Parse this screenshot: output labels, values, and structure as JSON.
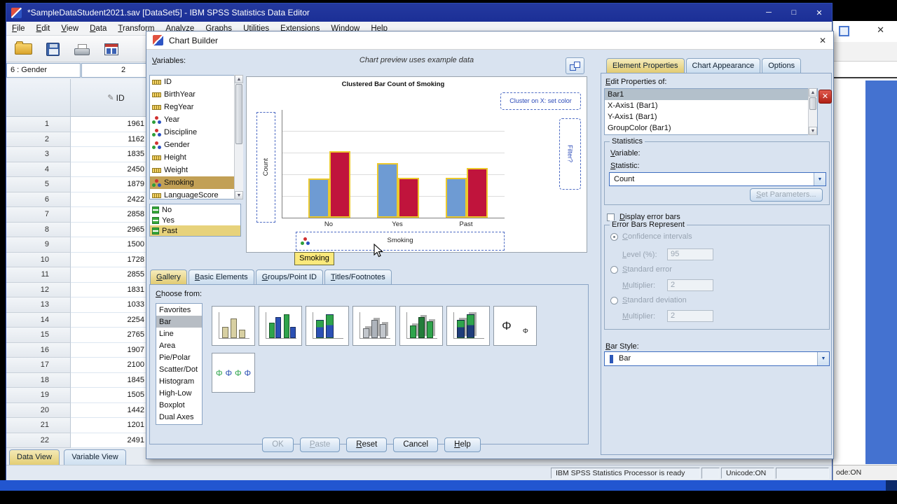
{
  "app": {
    "title": "*SampleDataStudent2021.sav [DataSet5] - IBM SPSS Statistics Data Editor",
    "menu": [
      "File",
      "Edit",
      "View",
      "Data",
      "Transform",
      "Analyze",
      "Graphs",
      "Utilities",
      "Extensions",
      "Window",
      "Help"
    ],
    "toolbar_icons": [
      "open-data",
      "save",
      "print",
      "recall-dialogs"
    ],
    "cell_ref": "6 : Gender",
    "cell_value": "2",
    "view_tabs": [
      "Data View",
      "Variable View"
    ],
    "status": {
      "processor": "IBM SPSS Statistics Processor is ready",
      "unicode": "Unicode:ON"
    }
  },
  "grid": {
    "id_header": "ID",
    "rows": [
      [
        "1",
        "1961"
      ],
      [
        "2",
        "1162"
      ],
      [
        "3",
        "1835"
      ],
      [
        "4",
        "2450"
      ],
      [
        "5",
        "1879"
      ],
      [
        "6",
        "2422"
      ],
      [
        "7",
        "2858"
      ],
      [
        "8",
        "2965"
      ],
      [
        "9",
        "1500"
      ],
      [
        "10",
        "1728"
      ],
      [
        "11",
        "2855"
      ],
      [
        "12",
        "1831"
      ],
      [
        "13",
        "1033"
      ],
      [
        "14",
        "2254"
      ],
      [
        "15",
        "2765"
      ],
      [
        "16",
        "1907"
      ],
      [
        "17",
        "2100"
      ],
      [
        "18",
        "1845"
      ],
      [
        "19",
        "1505"
      ],
      [
        "20",
        "1442"
      ],
      [
        "21",
        "1201"
      ],
      [
        "22",
        "2491"
      ]
    ]
  },
  "dialog": {
    "title": "Chart Builder",
    "variables_label": "Variables:",
    "preview_note": "Chart preview uses example data",
    "variables": [
      {
        "name": "ID",
        "type": "scale"
      },
      {
        "name": "BirthYear",
        "type": "scale"
      },
      {
        "name": "RegYear",
        "type": "scale"
      },
      {
        "name": "Year",
        "type": "nominal"
      },
      {
        "name": "Discipline",
        "type": "nominal"
      },
      {
        "name": "Gender",
        "type": "nominal"
      },
      {
        "name": "Height",
        "type": "scale"
      },
      {
        "name": "Weight",
        "type": "scale"
      },
      {
        "name": "Smoking",
        "type": "nominal",
        "selected": true
      },
      {
        "name": "LanguageScore",
        "type": "scale"
      }
    ],
    "categories": [
      {
        "name": "No"
      },
      {
        "name": "Yes"
      },
      {
        "name": "Past",
        "selected": true
      }
    ],
    "preview": {
      "cluster_hint": "Cluster on X: set color",
      "filter_hint": "Filter?",
      "tooltip": "Smoking"
    },
    "tabs": [
      {
        "label": "Gallery",
        "active": true
      },
      {
        "label": "Basic Elements",
        "active": false
      },
      {
        "label": "Groups/Point ID",
        "active": false
      },
      {
        "label": "Titles/Footnotes",
        "active": false
      }
    ],
    "choose_from": "Choose from:",
    "gallery_types": [
      {
        "label": "Favorites"
      },
      {
        "label": "Bar",
        "selected": true
      },
      {
        "label": "Line"
      },
      {
        "label": "Area"
      },
      {
        "label": "Pie/Polar"
      },
      {
        "label": "Scatter/Dot"
      },
      {
        "label": "Histogram"
      },
      {
        "label": "High-Low"
      },
      {
        "label": "Boxplot"
      },
      {
        "label": "Dual Axes"
      }
    ],
    "gallery_icons": [
      "simple-bar",
      "clustered-bar",
      "stacked-bar",
      "simple-3d-bar",
      "clustered-3d-bar",
      "stacked-3d-bar",
      "simple-error-bar",
      "clustered-error-bar"
    ],
    "buttons": [
      {
        "label": "OK",
        "enabled": false
      },
      {
        "label": "Paste",
        "enabled": false
      },
      {
        "label": "Reset",
        "enabled": true
      },
      {
        "label": "Cancel",
        "enabled": true
      },
      {
        "label": "Help",
        "enabled": true
      }
    ]
  },
  "properties": {
    "tabs": [
      {
        "label": "Element Properties",
        "active": true
      },
      {
        "label": "Chart Appearance",
        "active": false
      },
      {
        "label": "Options",
        "active": false
      }
    ],
    "edit_label": "Edit Properties of:",
    "items": [
      {
        "label": "Bar1",
        "selected": true
      },
      {
        "label": "X-Axis1 (Bar1)"
      },
      {
        "label": "Y-Axis1 (Bar1)"
      },
      {
        "label": "GroupColor (Bar1)"
      }
    ],
    "statistics": {
      "group_label": "Statistics",
      "variable_label": "Variable:",
      "statistic_label": "Statistic:",
      "statistic_value": "Count",
      "set_parameters": "Set Parameters..."
    },
    "error_bars": {
      "checkbox": "Display error bars",
      "group_label": "Error Bars Represent",
      "options": [
        {
          "label": "Confidence intervals",
          "selected": true
        },
        {
          "label": "Standard error",
          "selected": false
        },
        {
          "label": "Standard deviation",
          "selected": false
        }
      ],
      "level_label": "Level (%):",
      "level_value": "95",
      "multiplier_label": "Multiplier:",
      "multiplier_value": "2",
      "multiplier2_value": "2"
    },
    "bar_style_label": "Bar Style:",
    "bar_style_value": "Bar"
  },
  "chart_data": {
    "type": "bar",
    "title": "Clustered Bar Count of Smoking",
    "categories": [
      "No",
      "Yes",
      "Past"
    ],
    "series": [
      {
        "name": "blue",
        "color": "#6e9bd3",
        "values": [
          0.36,
          0.5,
          0.37
        ]
      },
      {
        "name": "red",
        "color": "#c0143c",
        "values": [
          0.61,
          0.37,
          0.46
        ]
      }
    ],
    "ylabel": "Count",
    "xlabel": "Smoking",
    "legend": "none",
    "grid": true,
    "note": "preview uses example data; no numeric y tick labels shown, values are relative bar heights"
  },
  "colors": {
    "titlebar": "#1d33a2",
    "dialog_bg": "#d9e3f0",
    "active_tab": "#e8d487",
    "selection_tan": "#c2a055",
    "selection_yellow": "#e7d27b",
    "bar_highlight": "#ecc92c"
  },
  "behind_window": {
    "status_text": "ode:ON"
  }
}
